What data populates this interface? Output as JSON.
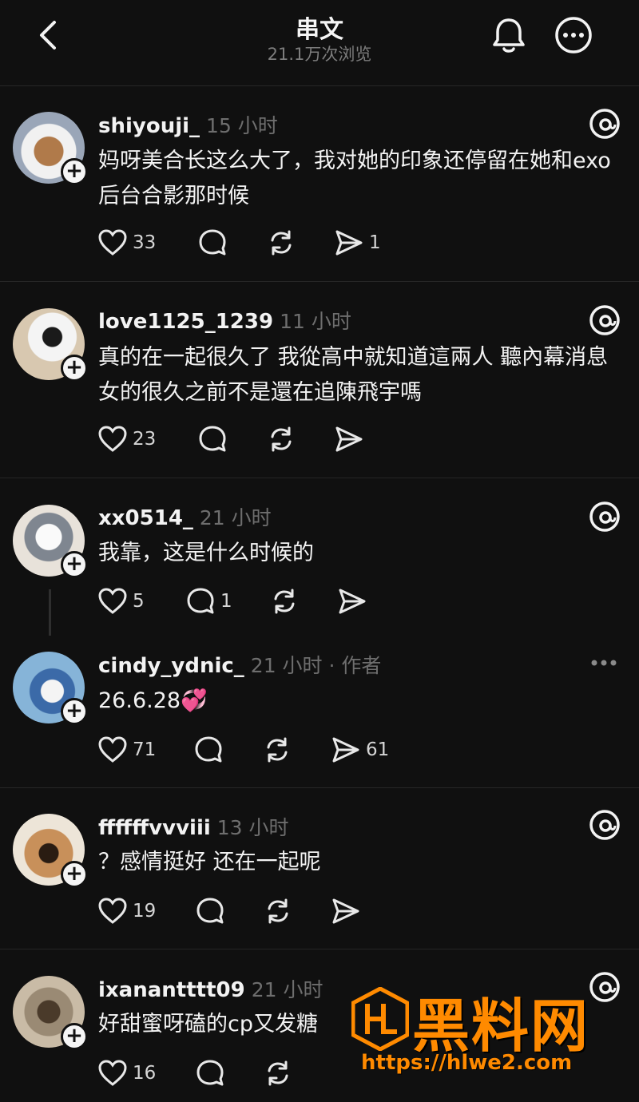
{
  "header": {
    "title": "串文",
    "subtitle": "21.1万次浏览"
  },
  "posts": [
    {
      "username": "shiyouji_",
      "time": "15 小时",
      "text": "妈呀美合长这么大了，我对她的印象还停留在她和exo后台合影那时候",
      "likes": "33",
      "comments": "",
      "shares": "1"
    },
    {
      "username": "love1125_1239",
      "time": "11 小时",
      "text": "真的在一起很久了 我從高中就知道這兩人 聽內幕消息 女的很久之前不是還在追陳飛宇嗎",
      "likes": "23",
      "comments": "",
      "shares": ""
    },
    {
      "username": "xx0514_",
      "time": "21 小时",
      "text": "我靠，这是什么时候的",
      "likes": "5",
      "comments": "1",
      "shares": ""
    },
    {
      "username": "cindy_ydnic_",
      "time": "21 小时 · 作者",
      "text": "26.6.28💞",
      "likes": "71",
      "comments": "",
      "shares": "61"
    },
    {
      "username": "ffffffvvviii",
      "time": "13 小时",
      "text": "？感情挺好 还在一起呢",
      "likes": "19",
      "comments": "",
      "shares": ""
    },
    {
      "username": "ixanantttt09",
      "time": "21 小时",
      "text": "好甜蜜呀磕的cp又发糖",
      "likes": "16",
      "comments": "",
      "shares": ""
    }
  ],
  "watermark": {
    "name": "黑料网",
    "url": "https://hlwe2.com"
  },
  "colors": {
    "background": "#101010",
    "text": "#f3f3f3",
    "muted": "#6e6e6e",
    "watermark": "#ff8a00"
  }
}
